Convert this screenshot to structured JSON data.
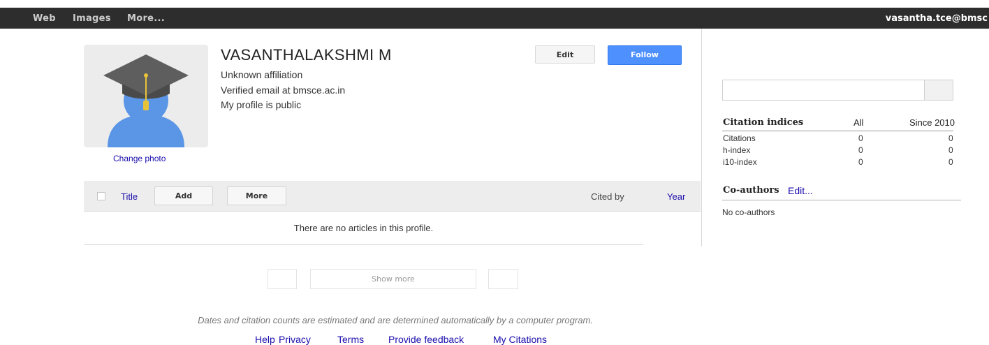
{
  "topbar": {
    "web": "Web",
    "images": "Images",
    "more": "More...",
    "user": "vasantha.tce@bmsc"
  },
  "profile": {
    "name": "VASANTHALAKSHMI M",
    "affiliation": "Unknown affiliation",
    "email": "Verified email at bmsce.ac.in",
    "visibility": "My profile is public",
    "change_photo": "Change photo",
    "edit_label": "Edit",
    "follow_label": "Follow"
  },
  "toolbar": {
    "title": "Title",
    "add": "Add",
    "more": "More",
    "cited_by": "Cited by",
    "year": "Year"
  },
  "articles": {
    "empty_message": "There are no articles in this profile.",
    "show_more": "Show more"
  },
  "disclaimer": "Dates and citation counts are estimated and are determined automatically by a computer program.",
  "footer": {
    "help": "Help",
    "privacy": "Privacy",
    "terms": "Terms",
    "feedback": "Provide feedback",
    "my_citations": "My Citations"
  },
  "citations": {
    "header": "Citation indices",
    "col_all": "All",
    "col_since": "Since 2010",
    "rows": [
      {
        "label": "Citations",
        "all": "0",
        "since": "0"
      },
      {
        "label": "h-index",
        "all": "0",
        "since": "0"
      },
      {
        "label": "i10-index",
        "all": "0",
        "since": "0"
      }
    ]
  },
  "coauthors": {
    "title": "Co-authors",
    "edit": "Edit...",
    "empty": "No co-authors"
  },
  "colors": {
    "accent": "#4d90fe",
    "link": "#1a0dab",
    "topbar": "#2d2d2d"
  },
  "icons": {
    "avatar": "graduation-cap-user-icon"
  }
}
